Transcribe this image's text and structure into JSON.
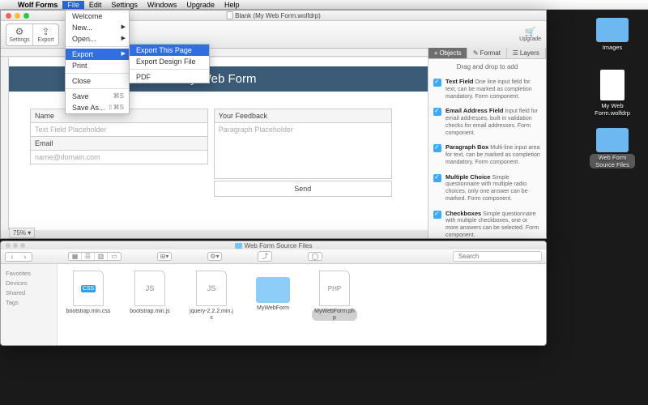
{
  "menubar": {
    "app": "Wolf Forms",
    "items": [
      "File",
      "Edit",
      "Settings",
      "Windows",
      "Upgrade",
      "Help"
    ]
  },
  "file_menu": {
    "welcome": "Welcome",
    "new": "New...",
    "open": "Open...",
    "export": "Export",
    "print": "Print",
    "close": "Close",
    "save": "Save",
    "save_sc": "⌘S",
    "saveas": "Save As...",
    "saveas_sc": "⇧⌘S"
  },
  "submenu": {
    "ep": "Export This Page",
    "edf": "Export Design File",
    "pdf": "PDF"
  },
  "window": {
    "title": "Blank (My Web Form.wolfdrp)"
  },
  "toolbar": {
    "settings": "Settings",
    "export": "Export",
    "upgrade": "Upgrade"
  },
  "zoom": "75%",
  "form": {
    "title": "My Web Form",
    "name_lbl": "Name",
    "tf_ph": "Text Field Placeholder",
    "email_lbl": "Email",
    "email_ph": "name@domain.com",
    "fb_lbl": "Your Feedback",
    "para_ph": "Paragraph Placeholder",
    "send": "Send"
  },
  "side": {
    "tabs": {
      "objects": "Objects",
      "format": "Format",
      "layers": "Layers"
    },
    "hint": "Drag and drop to add",
    "items": [
      {
        "t": "Text Field",
        "d": "One line input field for text, can be marked as completion mandatory. Form component."
      },
      {
        "t": "Email Address Field",
        "d": "Input field for email addresses, built in validation checks for email addresses. Form component."
      },
      {
        "t": "Paragraph Box",
        "d": "Multi-line input area for text, can be marked as completion mandatory. Form component."
      },
      {
        "t": "Multiple Choice",
        "d": "Simple questionnaire with multiple radio choices, only one answer can be marked. Form component."
      },
      {
        "t": "Checkboxes",
        "d": "Simple questionnaire with multiple checkboxes, one or more answers can be selected. Form component."
      }
    ]
  },
  "finder": {
    "title": "Web Form Source Files",
    "search_ph": "Search",
    "side": [
      "Favorites",
      "Devices",
      "Shared",
      "Tags"
    ],
    "files": [
      "bootstrap.min.css",
      "bootstrap.min.js",
      "jquery-2.2.2.min.js",
      "MyWebForm",
      "MyWebForm.php"
    ]
  },
  "desktop": {
    "images": "Images",
    "doc": "My Web Form.wolfdrp",
    "src": "Web Form Source Files"
  }
}
